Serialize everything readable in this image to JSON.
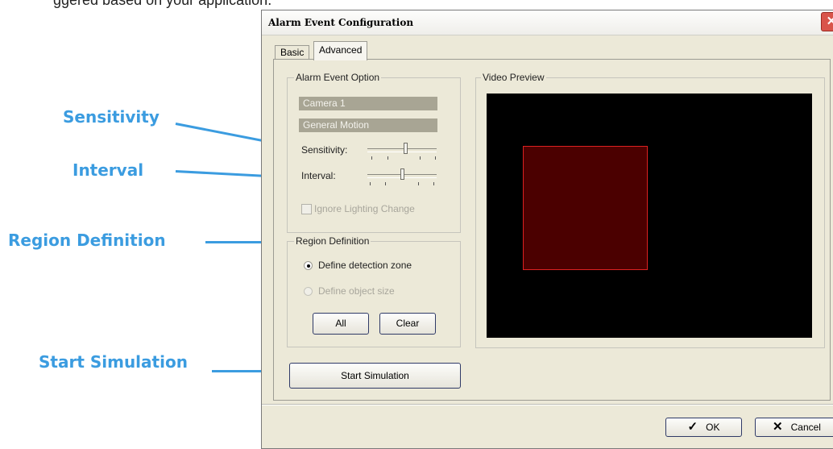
{
  "top_text": "ggered based on your application.",
  "callouts": {
    "sensitivity": "Sensitivity",
    "interval": "Interval",
    "region_definition": "Region Definition",
    "start_simulation": "Start Simulation"
  },
  "colors": {
    "callout": "#3b9ce0",
    "zone_fill": "#4b0000",
    "zone_border": "#dd2222",
    "video_bg": "#000000"
  },
  "dialog": {
    "title": "Alarm Event Configuration",
    "close_icon": "close-icon",
    "tabs": [
      {
        "label": "Basic"
      },
      {
        "label": "Advanced",
        "active": true
      }
    ],
    "alarm_event_option": {
      "label": "Alarm Event Option",
      "camera": "Camera 1",
      "event_type": "General Motion",
      "sensitivity_label": "Sensitivity:",
      "sensitivity_level": 0.5,
      "interval_label": "Interval:",
      "interval_level": 0.5,
      "ignore_lighting_label": "Ignore Lighting Change"
    },
    "region_definition": {
      "label": "Region Definition",
      "option_zone": "Define detection zone",
      "option_object": "Define object size",
      "selected": "Define detection zone",
      "all_label": "All",
      "clear_label": "Clear"
    },
    "start_simulation_label": "Start Simulation",
    "video_preview": {
      "label": "Video Preview"
    },
    "ok_label": "OK",
    "cancel_label": "Cancel",
    "ok_icon": "check-icon",
    "cancel_icon": "x-icon"
  }
}
